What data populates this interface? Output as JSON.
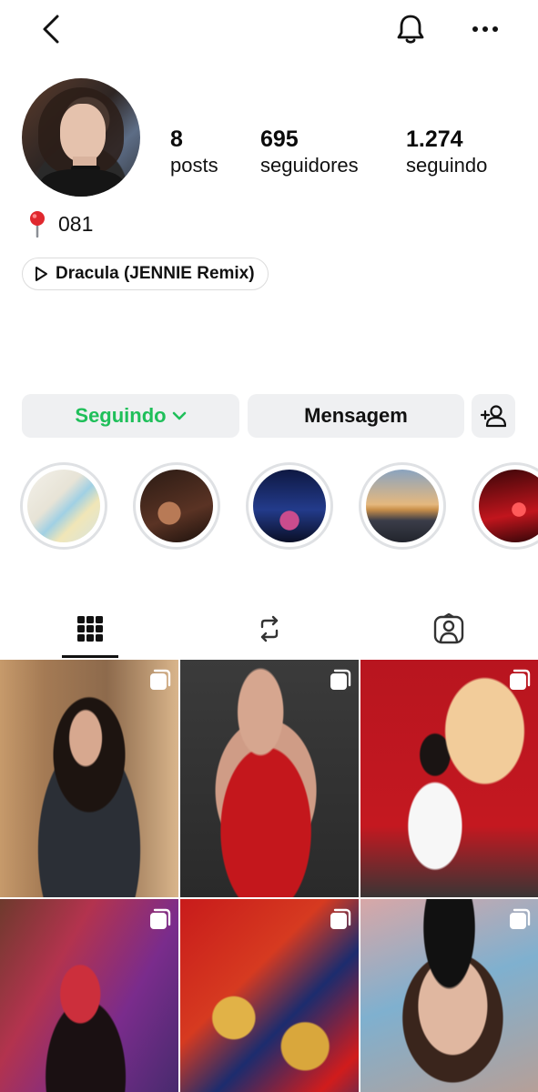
{
  "topbar": {
    "back_icon": "chevron-left-icon",
    "bell_icon": "bell-icon",
    "more_icon": "more-horizontal-icon"
  },
  "profile": {
    "stats": [
      {
        "value": "8",
        "label": "posts"
      },
      {
        "value": "695",
        "label": "seguidores"
      },
      {
        "value": "1.274",
        "label": "seguindo"
      }
    ],
    "location_icon": "pin-icon",
    "location_text": "081",
    "music_icon": "play-icon",
    "music_text": "Dracula (JENNIE Remix)"
  },
  "actions": {
    "follow_label": "Seguindo",
    "message_label": "Mensagem",
    "add_icon": "add-person-icon",
    "accent": "#1fbf5a"
  },
  "highlights": [
    "highlight-1",
    "highlight-2",
    "highlight-3",
    "highlight-4",
    "highlight-5"
  ],
  "tabs": [
    {
      "name": "grid",
      "icon": "grid-icon",
      "active": true
    },
    {
      "name": "reposts",
      "icon": "repost-icon",
      "active": false
    },
    {
      "name": "tagged",
      "icon": "tagged-person-icon",
      "active": false
    }
  ],
  "grid_posts": [
    {
      "multi": true
    },
    {
      "multi": true
    },
    {
      "multi": true
    },
    {
      "multi": true
    },
    {
      "multi": true
    },
    {
      "multi": true
    }
  ]
}
